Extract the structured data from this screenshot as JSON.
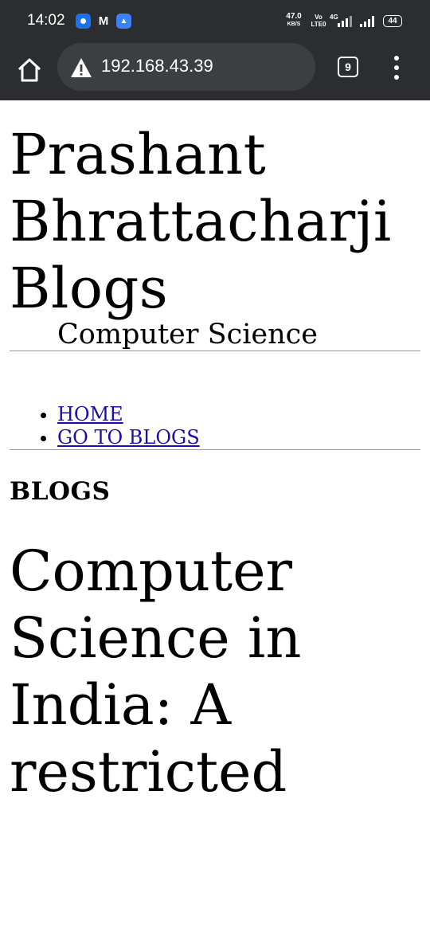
{
  "status_bar": {
    "time": "14:02",
    "speed_value": "47.0",
    "speed_unit": "KB/S",
    "vo_top": "Vo",
    "vo_bottom": "LTE0",
    "network": "4G",
    "battery": "44"
  },
  "browser": {
    "url": "192.168.43.39",
    "tab_count": "9",
    "icons": [
      "home-icon",
      "warning-icon",
      "tabs-icon",
      "more-icon"
    ]
  },
  "site": {
    "title": "Prashant Bhrattacharji Blogs",
    "subtitle": "Computer Science"
  },
  "nav": {
    "items": [
      {
        "label": "HOME"
      },
      {
        "label": "GO TO BLOGS"
      }
    ]
  },
  "section": {
    "heading": "BLOGS"
  },
  "post": {
    "title": "Computer Science in India: A restricted"
  }
}
